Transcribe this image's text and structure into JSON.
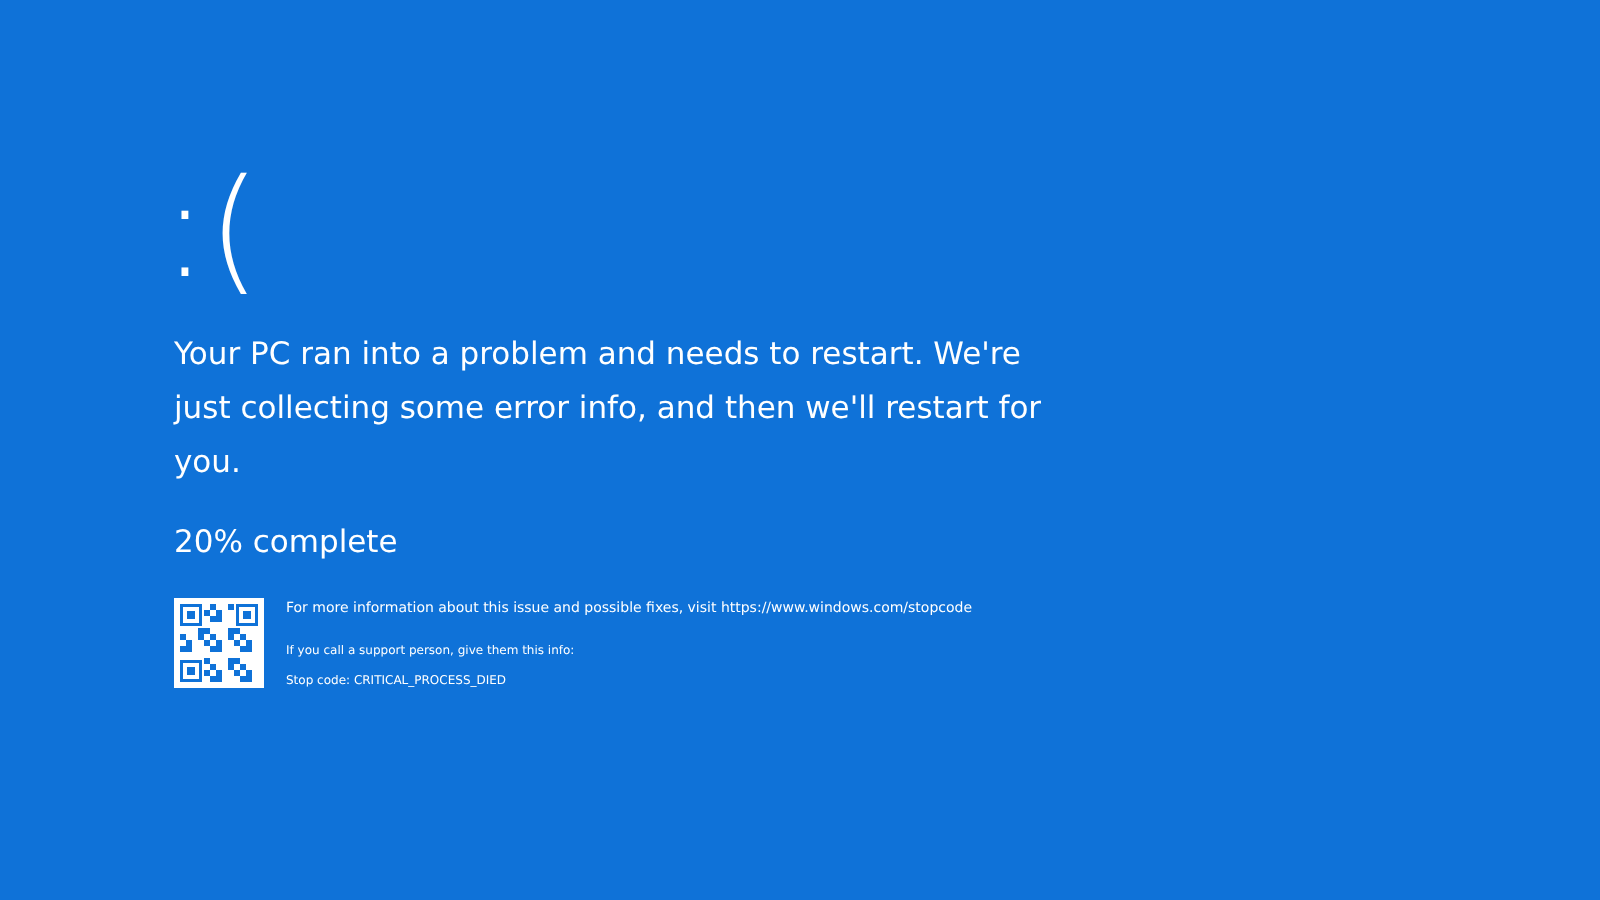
{
  "face": ":(",
  "message": "Your PC ran into a problem and needs to restart. We're just collecting some error info, and then we'll restart for you.",
  "progress": "20% complete",
  "info": {
    "more_info": "For more information about this issue and possible fixes, visit https://www.windows.com/stopcode",
    "support": "If you call a support person, give them this info:",
    "stop_code": "Stop code: CRITICAL_PROCESS_DIED"
  }
}
